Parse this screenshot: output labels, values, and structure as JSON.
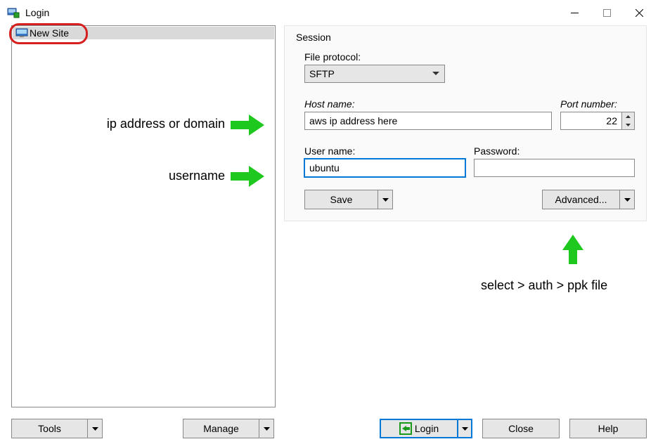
{
  "window": {
    "title": "Login"
  },
  "sites": {
    "new_site_label": "New Site"
  },
  "session": {
    "legend": "Session",
    "file_protocol_label": "File protocol:",
    "file_protocol_value": "SFTP",
    "host_label": "Host name:",
    "host_value": "aws ip address here",
    "port_label": "Port number:",
    "port_value": "22",
    "user_label": "User name:",
    "user_value": "ubuntu",
    "password_label": "Password:",
    "password_value": "",
    "save_label": "Save",
    "advanced_label": "Advanced..."
  },
  "footer": {
    "tools_label": "Tools",
    "manage_label": "Manage",
    "login_label": "Login",
    "close_label": "Close",
    "help_label": "Help"
  },
  "annotations": {
    "host_hint": "ip address or domain",
    "user_hint": "username",
    "advanced_hint": "select > auth > ppk file"
  }
}
